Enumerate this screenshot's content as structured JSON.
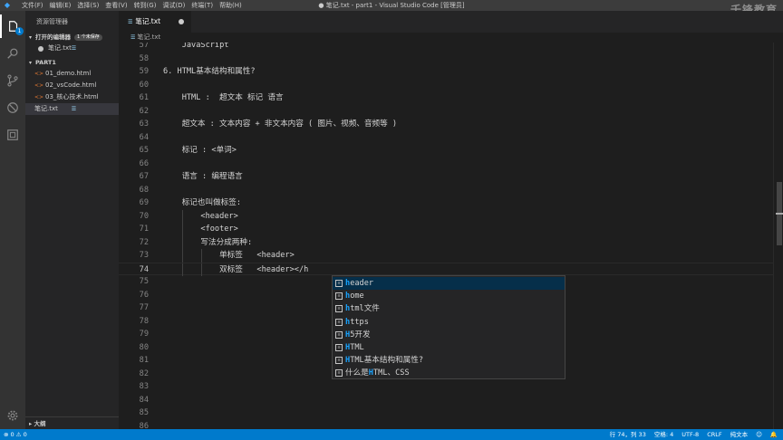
{
  "window": {
    "title": "● 笔记.txt - part1 - Visual Studio Code [管理员]",
    "watermark": "千锋教育"
  },
  "menu": [
    "文件(F)",
    "编辑(E)",
    "选择(S)",
    "查看(V)",
    "转到(G)",
    "调试(D)",
    "终端(T)",
    "帮助(H)"
  ],
  "activity": {
    "badge": "1"
  },
  "sidebar": {
    "title": "资源管理器",
    "open_editors": {
      "label": "打开的编辑器",
      "pill": "1 个未保存",
      "items": [
        {
          "name": "笔记.txt"
        }
      ]
    },
    "folder": {
      "label": "PART1",
      "items": [
        {
          "name": "01_demo.html",
          "kind": "html"
        },
        {
          "name": "02_vsCode.html",
          "kind": "html"
        },
        {
          "name": "03_核心技术.html",
          "kind": "html"
        },
        {
          "name": "笔记.txt",
          "kind": "txt"
        }
      ]
    },
    "outline": "大纲"
  },
  "editor": {
    "tab": "笔记.txt",
    "breadcrumb": "笔记.txt",
    "lines": [
      {
        "n": "57",
        "text": "    JavaScript"
      },
      {
        "n": "58",
        "text": ""
      },
      {
        "n": "59",
        "text": "6. HTML基本结构和属性?"
      },
      {
        "n": "60",
        "text": ""
      },
      {
        "n": "61",
        "text": "    HTML :  超文本 标记 语言"
      },
      {
        "n": "62",
        "text": ""
      },
      {
        "n": "63",
        "text": "    超文本 : 文本内容 + 非文本内容 ( 图片、视频、音频等 )"
      },
      {
        "n": "64",
        "text": ""
      },
      {
        "n": "65",
        "text": "    标记 : <单词>"
      },
      {
        "n": "66",
        "text": ""
      },
      {
        "n": "67",
        "text": "    语言 : 编程语言"
      },
      {
        "n": "68",
        "text": ""
      },
      {
        "n": "69",
        "text": "    标记也叫做标签:"
      },
      {
        "n": "70",
        "text": "        <header>"
      },
      {
        "n": "71",
        "text": "        <footer>"
      },
      {
        "n": "72",
        "text": "        写法分成两种:"
      },
      {
        "n": "73",
        "text": "            单标签   <header>"
      },
      {
        "n": "74",
        "text": "            双标签   <header></h"
      },
      {
        "n": "75",
        "text": ""
      },
      {
        "n": "76",
        "text": ""
      },
      {
        "n": "77",
        "text": ""
      },
      {
        "n": "78",
        "text": ""
      },
      {
        "n": "79",
        "text": ""
      },
      {
        "n": "80",
        "text": ""
      },
      {
        "n": "81",
        "text": ""
      },
      {
        "n": "82",
        "text": ""
      },
      {
        "n": "83",
        "text": ""
      },
      {
        "n": "84",
        "text": ""
      },
      {
        "n": "85",
        "text": ""
      },
      {
        "n": "86",
        "text": ""
      }
    ],
    "current_line": "74"
  },
  "suggest": {
    "items": [
      {
        "match": "h",
        "rest": "eader"
      },
      {
        "match": "h",
        "rest": "ome"
      },
      {
        "match": "h",
        "rest": "tml文件"
      },
      {
        "match": "h",
        "rest": "ttps"
      },
      {
        "match": "H",
        "rest": "5开发"
      },
      {
        "match": "H",
        "rest": "TML"
      },
      {
        "match": "H",
        "rest": "TML基本结构和属性?"
      },
      {
        "prefix": "什么是",
        "match": "H",
        "rest": "TML、CSS"
      }
    ]
  },
  "statusbar": {
    "problems": "⊗ 0 ⚠ 0",
    "position": "行 74，列 33",
    "spaces": "空格: 4",
    "encoding": "UTF-8",
    "eol": "CRLF",
    "language": "纯文本",
    "feedback": "☺",
    "bell": "🔔"
  },
  "colors": {
    "accent": "#007acc",
    "match_highlight": "#18a3ff",
    "editor_bg": "#1e1e1e",
    "sidebar_bg": "#252526"
  }
}
